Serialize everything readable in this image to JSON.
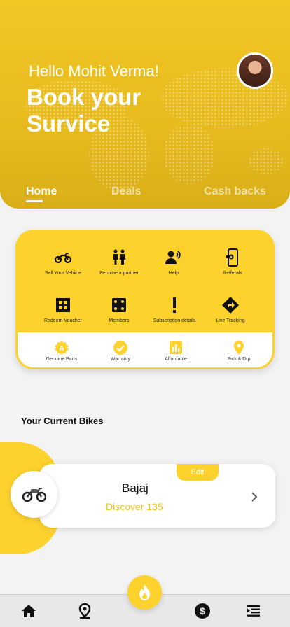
{
  "header": {
    "greeting": "Hello Mohit Verma!",
    "headline": "Book your Survice",
    "tabs": [
      {
        "label": "Home",
        "active": true
      },
      {
        "label": "Deals",
        "active": false
      },
      {
        "label": "Cash backs",
        "active": false
      }
    ]
  },
  "services": {
    "items": [
      {
        "label": "Sell Your Vehicle",
        "icon": "motorcycle-icon"
      },
      {
        "label": "Become a partner",
        "icon": "people-icon"
      },
      {
        "label": "Help",
        "icon": "support-agent-icon"
      },
      {
        "label": "Refferals",
        "icon": "phone-settings-icon"
      },
      {
        "label": "Redeem Voucher",
        "icon": "voucher-icon"
      },
      {
        "label": "Members",
        "icon": "dice-icon"
      },
      {
        "label": "Subscription details",
        "icon": "exclamation-icon"
      },
      {
        "label": "Live Tracking",
        "icon": "directions-icon"
      }
    ],
    "features": [
      {
        "label": "Genuine Parts",
        "icon": "badge-icon"
      },
      {
        "label": "Warranty",
        "icon": "check-circle-icon"
      },
      {
        "label": "Affordable",
        "icon": "bar-chart-icon"
      },
      {
        "label": "Pick & Drp",
        "icon": "location-pin-icon"
      }
    ]
  },
  "bikes": {
    "section_title": "Your Current Bikes",
    "edit_label": "Edit",
    "brand": "Bajaj",
    "model": "Discover 135"
  },
  "colors": {
    "accent": "#fdd22d",
    "header": "#f2c623",
    "model_text": "#f0c31c"
  },
  "bottom_nav": [
    "home-icon",
    "location-pin-icon",
    "fire-icon",
    "dollar-icon",
    "menu-icon"
  ]
}
